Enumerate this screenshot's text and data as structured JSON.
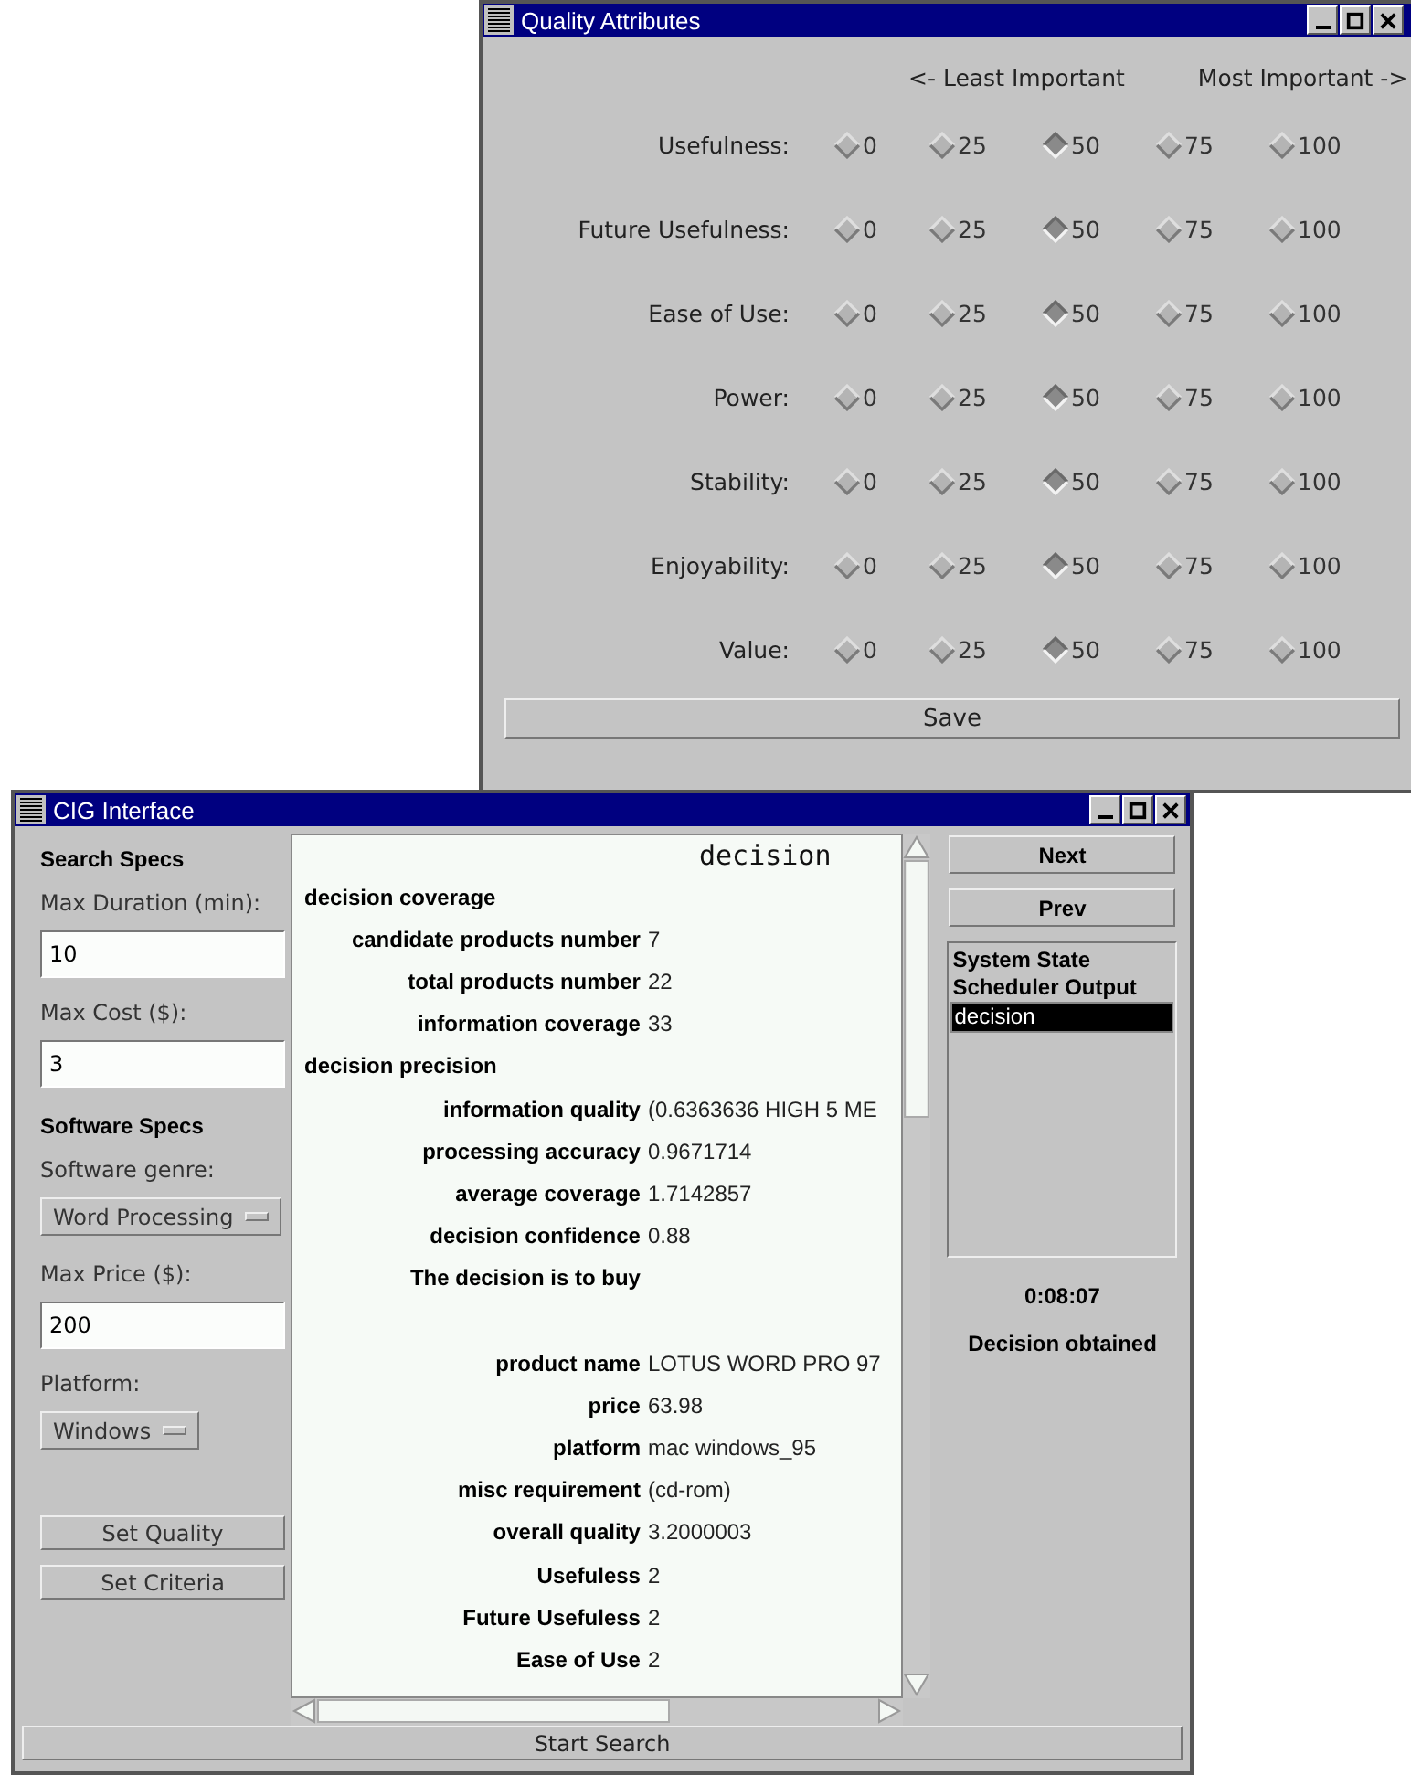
{
  "quality_window": {
    "title": "Quality Attributes",
    "header_left": "<- Least Important",
    "header_right": "Most Important ->",
    "attributes": [
      {
        "label": "Usefulness:",
        "options": [
          {
            "value": "0",
            "selected": false
          },
          {
            "value": "25",
            "selected": false
          },
          {
            "value": "50",
            "selected": true
          },
          {
            "value": "75",
            "selected": false
          },
          {
            "value": "100",
            "selected": false
          }
        ]
      },
      {
        "label": "Future Usefulness:",
        "options": [
          {
            "value": "0",
            "selected": false
          },
          {
            "value": "25",
            "selected": false
          },
          {
            "value": "50",
            "selected": true
          },
          {
            "value": "75",
            "selected": false
          },
          {
            "value": "100",
            "selected": false
          }
        ]
      },
      {
        "label": "Ease of Use:",
        "options": [
          {
            "value": "0",
            "selected": false
          },
          {
            "value": "25",
            "selected": false
          },
          {
            "value": "50",
            "selected": true
          },
          {
            "value": "75",
            "selected": false
          },
          {
            "value": "100",
            "selected": false
          }
        ]
      },
      {
        "label": "Power:",
        "options": [
          {
            "value": "0",
            "selected": false
          },
          {
            "value": "25",
            "selected": false
          },
          {
            "value": "50",
            "selected": true
          },
          {
            "value": "75",
            "selected": false
          },
          {
            "value": "100",
            "selected": false
          }
        ]
      },
      {
        "label": "Stability:",
        "options": [
          {
            "value": "0",
            "selected": false
          },
          {
            "value": "25",
            "selected": false
          },
          {
            "value": "50",
            "selected": true
          },
          {
            "value": "75",
            "selected": false
          },
          {
            "value": "100",
            "selected": false
          }
        ]
      },
      {
        "label": "Enjoyability:",
        "options": [
          {
            "value": "0",
            "selected": false
          },
          {
            "value": "25",
            "selected": false
          },
          {
            "value": "50",
            "selected": true
          },
          {
            "value": "75",
            "selected": false
          },
          {
            "value": "100",
            "selected": false
          }
        ]
      },
      {
        "label": "Value:",
        "options": [
          {
            "value": "0",
            "selected": false
          },
          {
            "value": "25",
            "selected": false
          },
          {
            "value": "50",
            "selected": true
          },
          {
            "value": "75",
            "selected": false
          },
          {
            "value": "100",
            "selected": false
          }
        ]
      }
    ],
    "save_button": "Save"
  },
  "cig_window": {
    "title": "CIG Interface",
    "left_panel": [
      {
        "kind": "heading",
        "text": "Search Specs"
      },
      {
        "kind": "label",
        "text": "Max Duration (min):"
      },
      {
        "kind": "input",
        "value": "10"
      },
      {
        "kind": "label",
        "text": "Max Cost ($):"
      },
      {
        "kind": "input",
        "value": "3"
      },
      {
        "kind": "heading",
        "text": "Software Specs"
      },
      {
        "kind": "label",
        "text": "Software genre:"
      },
      {
        "kind": "dropdown",
        "value": "Word Processing"
      },
      {
        "kind": "label",
        "text": "Max Price ($):"
      },
      {
        "kind": "input",
        "value": "200"
      },
      {
        "kind": "label",
        "text": "Platform:"
      },
      {
        "kind": "dropdown",
        "value": "Windows"
      }
    ],
    "buttons": [
      "Set Quality",
      "Set Criteria"
    ],
    "output": {
      "title": "decision",
      "rows": [
        {
          "kind": "heading",
          "label": "decision coverage"
        },
        {
          "kind": "pair",
          "label": "candidate products number",
          "value": "7"
        },
        {
          "kind": "pair",
          "label": "total products number",
          "value": "22"
        },
        {
          "kind": "pair",
          "label": "information coverage",
          "value": "33"
        },
        {
          "kind": "heading",
          "label": "decision precision"
        },
        {
          "kind": "pair",
          "label": "information quality",
          "value": "(0.6363636 HIGH 5 ME"
        },
        {
          "kind": "pair",
          "label": "processing accuracy",
          "value": "0.9671714"
        },
        {
          "kind": "pair",
          "label": "average coverage",
          "value": "1.7142857"
        },
        {
          "kind": "pair",
          "label": "decision confidence",
          "value": "0.88"
        },
        {
          "kind": "pair",
          "label": "The decision is to buy"
        },
        {
          "kind": "blank"
        },
        {
          "kind": "pair",
          "label": "product name",
          "value": "LOTUS WORD PRO 97"
        },
        {
          "kind": "pair",
          "label": "price",
          "value": "63.98"
        },
        {
          "kind": "pair",
          "label": "platform",
          "value": " mac windows_95"
        },
        {
          "kind": "pair",
          "label": "misc requirement",
          "value": "(cd-rom)"
        },
        {
          "kind": "pair",
          "label": "overall quality",
          "value": "3.2000003"
        },
        {
          "kind": "pair",
          "label": "Usefuless",
          "value": "2"
        },
        {
          "kind": "pair",
          "label": "Future Usefuless",
          "value": "2"
        },
        {
          "kind": "pair",
          "label": "Ease of Use",
          "value": "2"
        }
      ]
    },
    "nav_buttons": [
      "Next",
      "Prev"
    ],
    "views": [
      {
        "label": "System State",
        "selected": false
      },
      {
        "label": "Scheduler Output",
        "selected": false
      },
      {
        "label": "decision",
        "selected": true
      }
    ],
    "elapsed": "0:08:07",
    "status": "Decision obtained",
    "start_button": "Start Search"
  }
}
